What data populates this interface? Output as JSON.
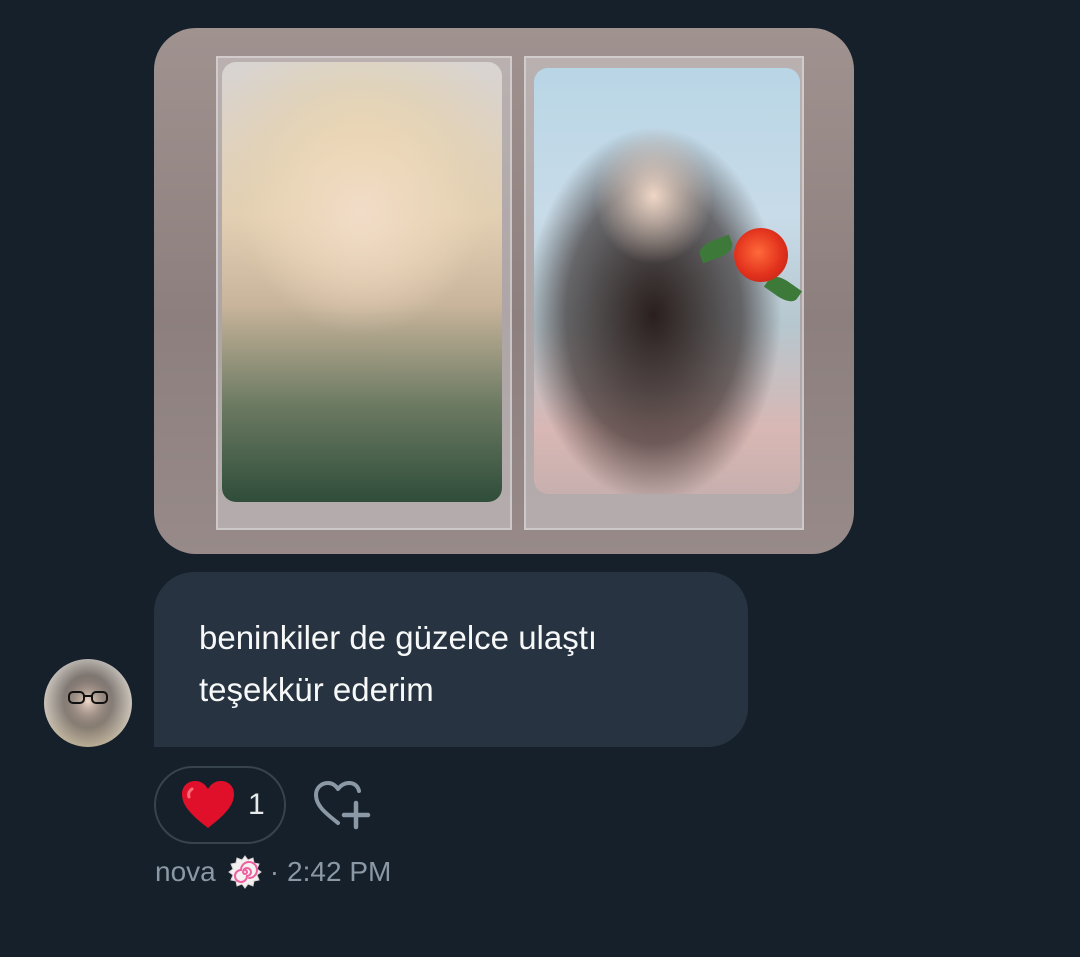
{
  "message": {
    "text_lines": [
      "beninkiler de güzelce ulaştı",
      "teşekkür ederim"
    ]
  },
  "reaction": {
    "emoji": "red-heart",
    "count": "1"
  },
  "add_reaction_icon": "heart-plus-icon",
  "meta": {
    "sender": "nova",
    "badge_icon": "narutomaki-icon",
    "separator": "·",
    "time": "2:42 PM"
  },
  "colors": {
    "background": "#15202b",
    "bubble": "#273340",
    "muted_text": "#8b98a5",
    "heart_red": "#e0102a"
  }
}
